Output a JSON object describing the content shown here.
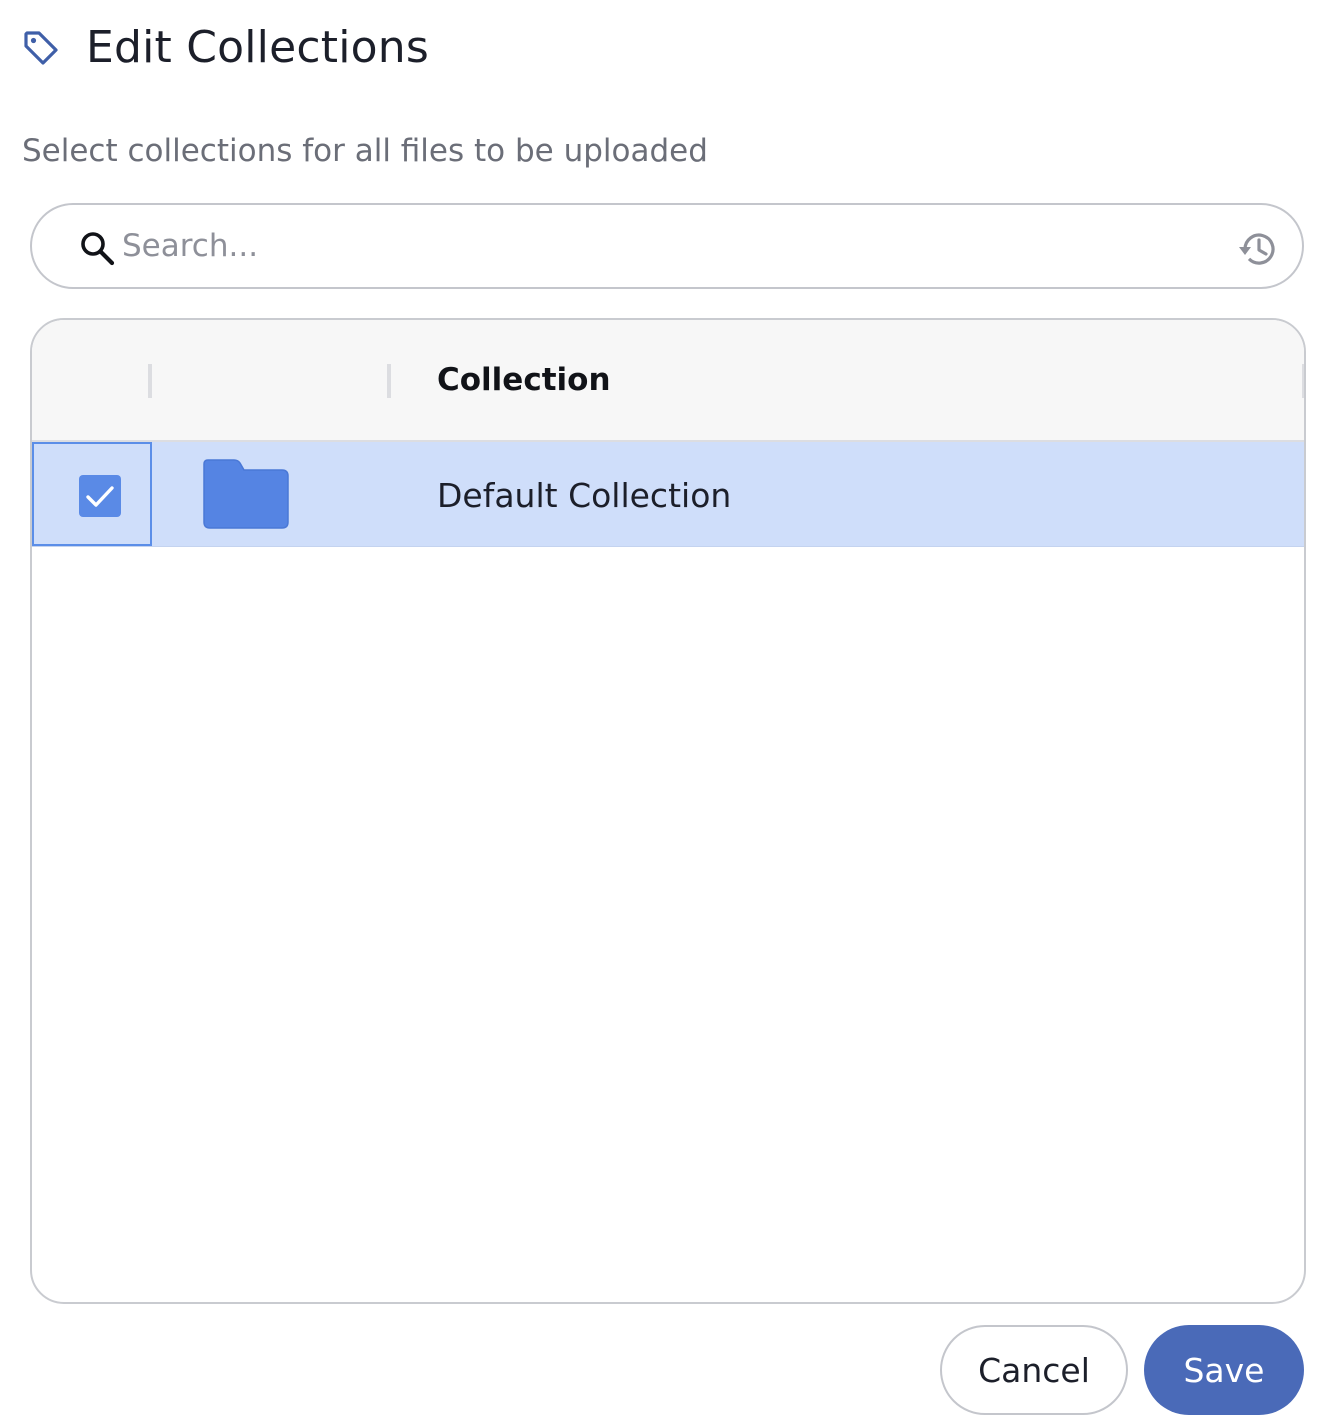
{
  "dialog": {
    "title": "Edit Collections",
    "title_icon": "tag-icon",
    "subtitle": "Select collections for all files to be uploaded"
  },
  "search": {
    "value": "",
    "placeholder": "Search...",
    "icon": "search-icon",
    "history_icon": "history-icon"
  },
  "table": {
    "columns": [
      "",
      "",
      "Collection"
    ],
    "rows": [
      {
        "selected": true,
        "icon": "folder-icon",
        "name": "Default Collection"
      }
    ]
  },
  "actions": {
    "cancel_label": "Cancel",
    "save_label": "Save"
  },
  "colors": {
    "accent": "#4a6ab8",
    "selected_row": "#cfdefa",
    "checkbox": "#5a8ae6",
    "folder": "#5584e3"
  }
}
